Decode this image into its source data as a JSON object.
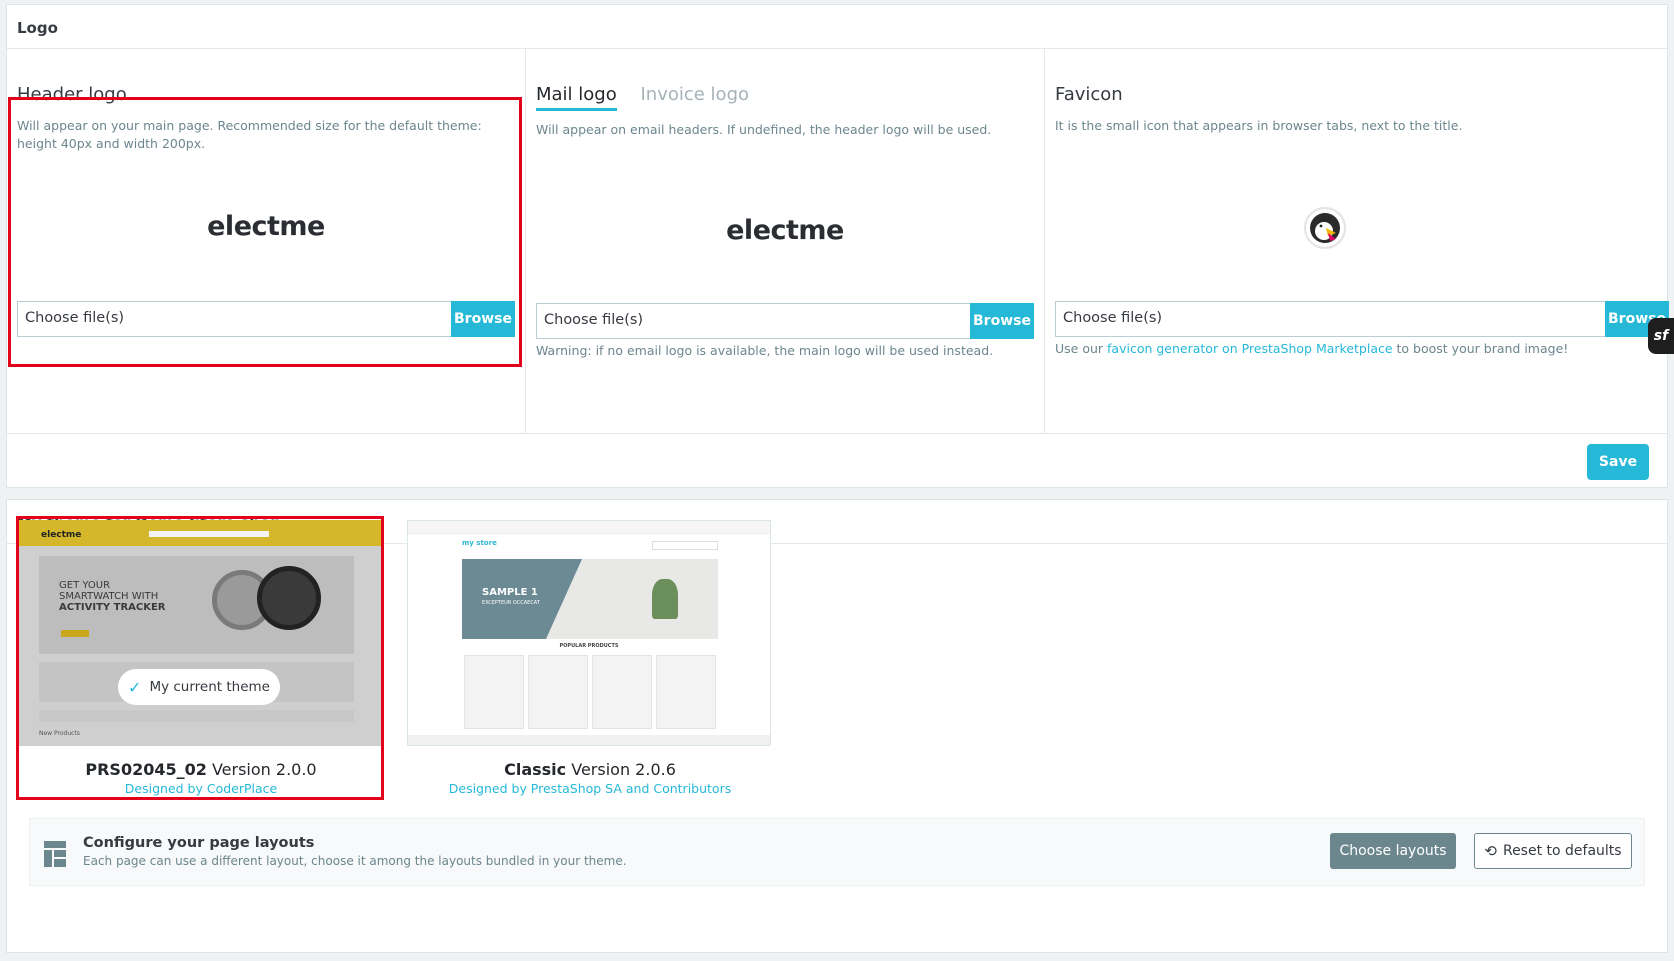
{
  "logo_section": {
    "title": "Logo",
    "header_logo": {
      "title": "Header logo",
      "description": "Will appear on your main page. Recommended size for the default theme: height 40px and width 200px.",
      "preview_text": "electme",
      "file_placeholder": "Choose file(s)",
      "browse_label": "Browse"
    },
    "mail_logo": {
      "tabs": [
        {
          "label": "Mail logo",
          "active": true
        },
        {
          "label": "Invoice logo",
          "active": false
        }
      ],
      "description": "Will appear on email headers. If undefined, the header logo will be used.",
      "preview_text": "electme",
      "file_placeholder": "Choose file(s)",
      "browse_label": "Browse",
      "warning": "Warning: if no email logo is available, the main logo will be used instead."
    },
    "favicon": {
      "title": "Favicon",
      "description": "It is the small icon that appears in browser tabs, next to the title.",
      "file_placeholder": "Choose file(s)",
      "browse_label": "Browse",
      "note_prefix": "Use our ",
      "note_link": "favicon generator on PrestaShop Marketplace",
      "note_suffix": " to boost your brand image!"
    },
    "save_label": "Save"
  },
  "theme_section": {
    "title": "My theme for Demo Store shop",
    "themes": [
      {
        "name": "PRS02045_02",
        "version": "Version 2.0.0",
        "designer": "Designed by CoderPlace",
        "current_badge": "My current theme",
        "shot": {
          "brand": "electme",
          "headline1": "GET YOUR",
          "headline2": "SMARTWATCH WITH",
          "headline3": "ACTIVITY TRACKER",
          "section": "New Products"
        }
      },
      {
        "name": "Classic",
        "version": "Version 2.0.6",
        "designer": "Designed by PrestaShop SA and Contributors",
        "shot": {
          "brand": "my store",
          "slide_title": "SAMPLE 1",
          "slide_sub": "EXCEPTEUR OCCAECAT",
          "section": "POPULAR PRODUCTS"
        }
      }
    ],
    "layouts": {
      "title": "Configure your page layouts",
      "description": "Each page can use a different layout, choose it among the layouts bundled in your theme.",
      "choose_label": "Choose layouts",
      "reset_label": "Reset to defaults"
    }
  },
  "symfony_badge": "sf",
  "colors": {
    "accent": "#25b9d7",
    "highlight_border": "#e3001b",
    "secondary_button": "#6c868e"
  }
}
